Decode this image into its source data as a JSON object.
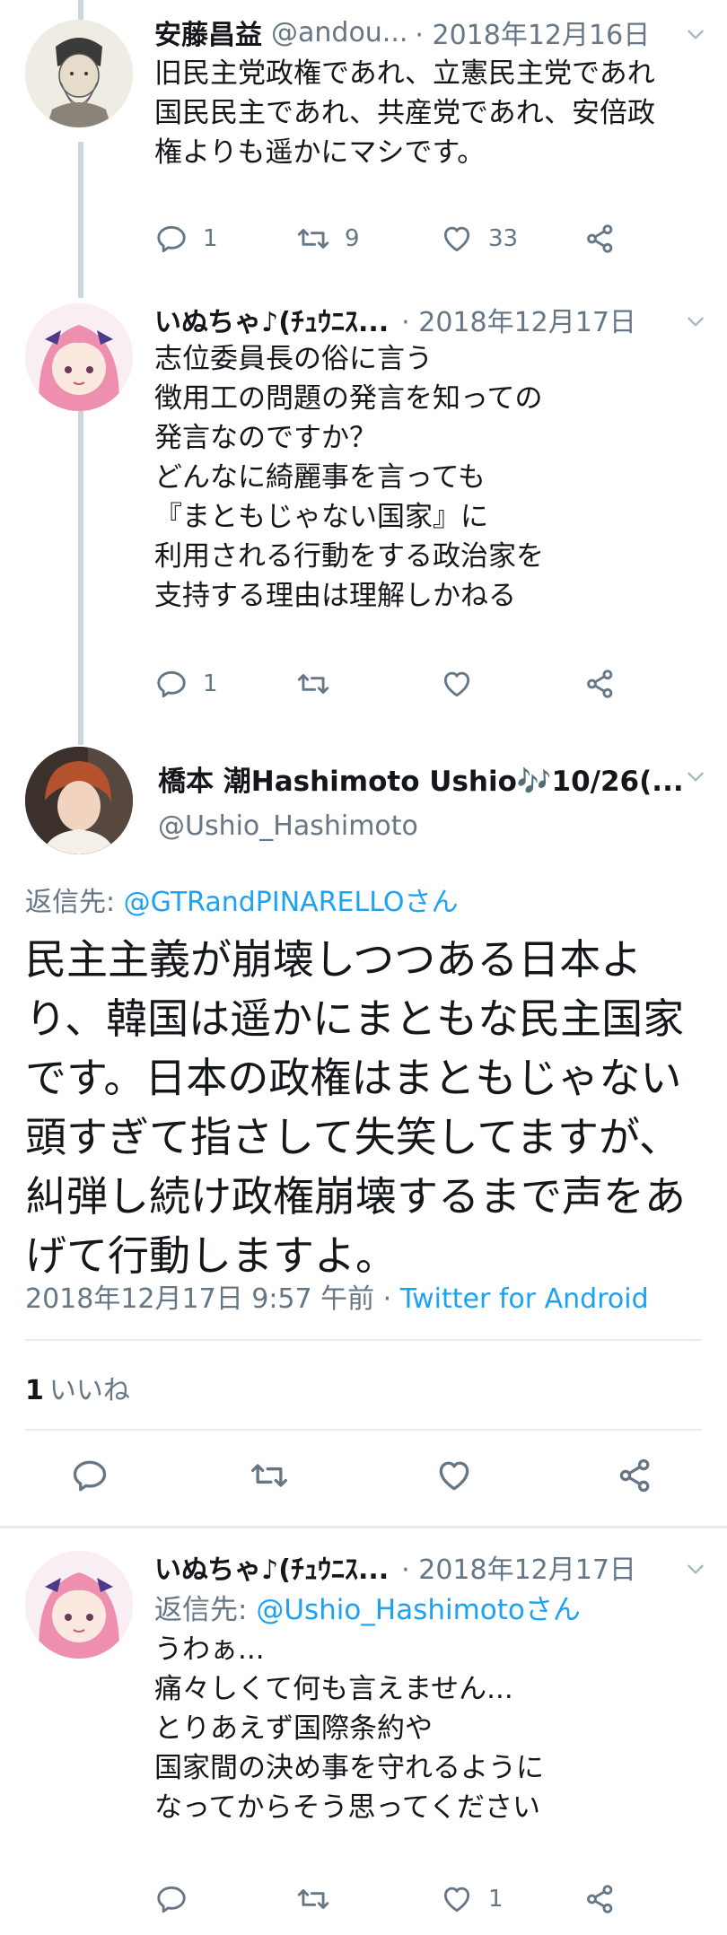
{
  "tweets": [
    {
      "name": "安藤昌益",
      "handle": "@andou...",
      "date": "· 2018年12月16日",
      "lines": [
        "旧民主党政権であれ、立憲民主党であれ",
        "国民民主であれ、共産党であれ、安倍政",
        "権よりも遥かにマシです。"
      ],
      "replies": "1",
      "retweets": "9",
      "likes": "33"
    },
    {
      "name": "いぬちゃ♪(ﾁｭｳﾆｽ...",
      "date": "· 2018年12月17日",
      "lines": [
        "志位委員長の俗に言う",
        "徴用工の問題の発言を知っての",
        "発言なのですか？",
        "どんなに綺麗事を言っても",
        "『まともじゃない国家』に",
        "利用される行動をする政治家を",
        "支持する理由は理解しかねる"
      ],
      "replies": "1",
      "retweets": "",
      "likes": ""
    }
  ],
  "main": {
    "name": "橋本 潮Hashimoto Ushio🎶10/26(...",
    "handle": "@Ushio_Hashimoto",
    "reply_prefix": "返信先: ",
    "reply_mention": "@GTRandPINARELLOさん",
    "lines": [
      "民主主義が崩壊しつつある日本よ",
      "り、韓国は遥かにまともな民主国家",
      "です。日本の政権はまともじゃない",
      "頭すぎて指さして失笑してますが、",
      "糾弾し続け政権崩壊するまで声をあ",
      "げて行動しますよ。"
    ],
    "timestamp": "2018年12月17日 9:57 午前 · ",
    "via": "Twitter for Android",
    "like_count": "1",
    "like_label": "いいね"
  },
  "reply": {
    "name": "いぬちゃ♪(ﾁｭｳﾆｽ...",
    "date": "· 2018年12月17日",
    "reply_prefix": "返信先: ",
    "reply_mention": "@Ushio_Hashimotoさん",
    "lines": [
      "うわぁ...",
      "痛々しくて何も言えません...",
      "とりあえず国際条約や",
      "国家間の決め事を守れるように",
      "なってからそう思ってください"
    ],
    "replies": "",
    "retweets": "",
    "likes": "1"
  },
  "icons": [
    "reply-icon",
    "retweet-icon",
    "like-icon",
    "share-icon",
    "chevron-down-icon"
  ],
  "colors": {
    "link": "#1da1f2",
    "muted": "#657786",
    "text": "#14171a",
    "thread": "#ccd6dd"
  }
}
